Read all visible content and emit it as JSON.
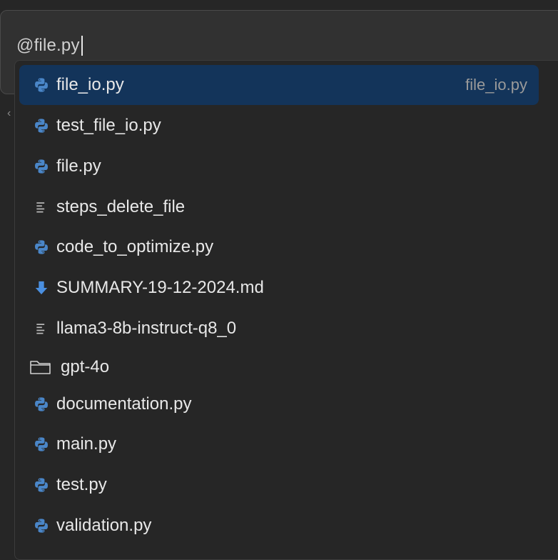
{
  "input": {
    "value": "@file.py"
  },
  "dropdown": {
    "items": [
      {
        "label": "file_io.py",
        "icon": "python-icon",
        "selected": true,
        "hint": "file_io.py"
      },
      {
        "label": "test_file_io.py",
        "icon": "python-icon"
      },
      {
        "label": "file.py",
        "icon": "python-icon"
      },
      {
        "label": "steps_delete_file",
        "icon": "text-file-icon"
      },
      {
        "label": "code_to_optimize.py",
        "icon": "python-icon"
      },
      {
        "label": "SUMMARY-19-12-2024.md",
        "icon": "markdown-download-icon"
      },
      {
        "label": "llama3-8b-instruct-q8_0",
        "icon": "text-file-icon"
      },
      {
        "label": "gpt-4o",
        "icon": "folder-icon"
      },
      {
        "label": "documentation.py",
        "icon": "python-icon"
      },
      {
        "label": "main.py",
        "icon": "python-icon"
      },
      {
        "label": "test.py",
        "icon": "python-icon"
      },
      {
        "label": "validation.py",
        "icon": "python-icon"
      }
    ]
  },
  "colors": {
    "background": "#262626",
    "selected": "#13345a",
    "python_blue": "#4a86c8",
    "markdown_blue": "#4a8fe0"
  }
}
